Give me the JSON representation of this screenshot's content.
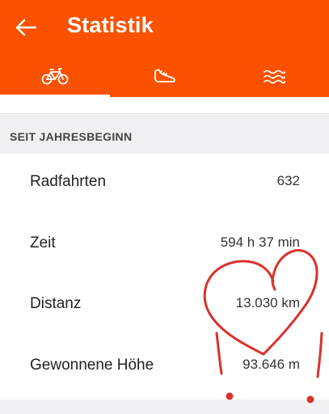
{
  "header": {
    "title": "Statistik"
  },
  "tabs": [
    {
      "icon": "bicycle-icon",
      "active": true
    },
    {
      "icon": "shoe-icon",
      "active": false
    },
    {
      "icon": "swim-icon",
      "active": false
    }
  ],
  "section": {
    "title": "SEIT JAHRESBEGINN"
  },
  "stats": [
    {
      "label": "Radfahrten",
      "value": "632"
    },
    {
      "label": "Zeit",
      "value": "594 h 37 min"
    },
    {
      "label": "Distanz",
      "value": "13.030 km"
    },
    {
      "label": "Gewonnene Höhe",
      "value": "93.646 m"
    }
  ],
  "colors": {
    "accent": "#fc5200",
    "annotation": "#d9322b"
  }
}
